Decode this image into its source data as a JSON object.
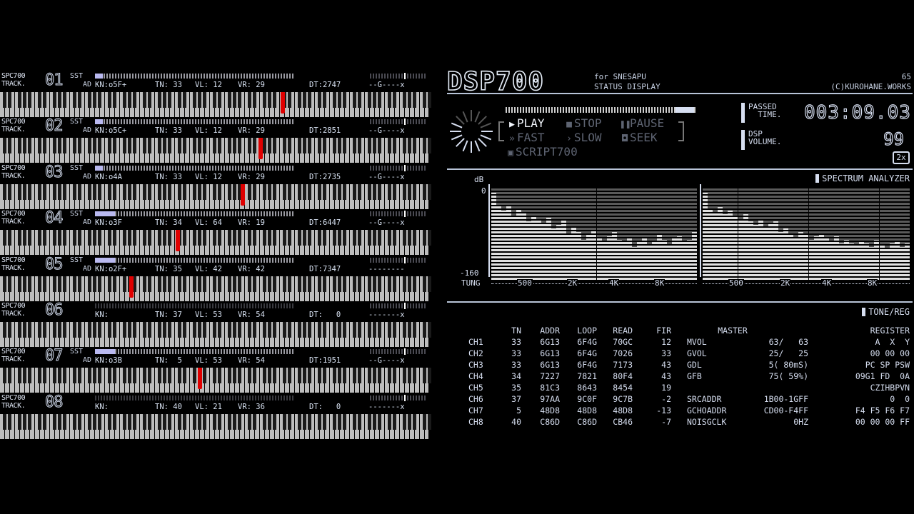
{
  "tracks": [
    {
      "spc": "SPC700",
      "label": "TRACK.",
      "num": "01",
      "sst": "SST",
      "ad": "AD",
      "kn": "KN:o5F+",
      "tn": "TN: 33",
      "vl": "VL: 12",
      "vr": "VR: 29",
      "dt": "DT:2747",
      "lfo": "--G----x",
      "env": 0.04,
      "note": 0.655,
      "active": true
    },
    {
      "spc": "SPC700",
      "label": "TRACK.",
      "num": "02",
      "sst": "SST",
      "ad": "AD",
      "kn": "KN:o5C+",
      "tn": "TN: 33",
      "vl": "VL: 12",
      "vr": "VR: 29",
      "dt": "DT:2851",
      "lfo": "--G----x",
      "env": 0.04,
      "note": 0.603,
      "active": true
    },
    {
      "spc": "SPC700",
      "label": "TRACK.",
      "num": "03",
      "sst": "SST",
      "ad": "AD",
      "kn": "KN:o4A",
      "tn": "TN: 33",
      "vl": "VL: 12",
      "vr": "VR: 29",
      "dt": "DT:2735",
      "lfo": "--G----x",
      "env": 0.04,
      "note": 0.561,
      "active": true
    },
    {
      "spc": "SPC700",
      "label": "TRACK.",
      "num": "04",
      "sst": "SST",
      "ad": "AD",
      "kn": "KN:o3F",
      "tn": "TN: 34",
      "vl": "VL: 64",
      "vr": "VR: 19",
      "dt": "DT:6447",
      "lfo": "--G----x",
      "env": 0.1,
      "note": 0.41,
      "active": true
    },
    {
      "spc": "SPC700",
      "label": "TRACK.",
      "num": "05",
      "sst": "SST",
      "ad": "AD",
      "kn": "KN:o2F+",
      "tn": "TN: 35",
      "vl": "VL: 42",
      "vr": "VR: 42",
      "dt": "DT:7347",
      "lfo": "--------",
      "env": 0.1,
      "note": 0.302,
      "active": true
    },
    {
      "spc": "SPC700",
      "label": "TRACK.",
      "num": "06",
      "sst": "",
      "ad": "",
      "kn": "KN:",
      "tn": "TN: 37",
      "vl": "VL: 53",
      "vr": "VR: 54",
      "dt": "DT:   0",
      "lfo": "-------x",
      "env": 0.0,
      "note": null,
      "active": false
    },
    {
      "spc": "SPC700",
      "label": "TRACK.",
      "num": "07",
      "sst": "SST",
      "ad": "AD",
      "kn": "KN:o3B",
      "tn": "TN:  5",
      "vl": "VL: 53",
      "vr": "VR: 54",
      "dt": "DT:1951",
      "lfo": "--G----x",
      "env": 0.1,
      "note": 0.462,
      "active": true
    },
    {
      "spc": "SPC700",
      "label": "TRACK.",
      "num": "08",
      "sst": "",
      "ad": "",
      "kn": "KN:",
      "tn": "TN: 40",
      "vl": "VL: 21",
      "vr": "VR: 36",
      "dt": "DT:   0",
      "lfo": "-------x",
      "env": 0.0,
      "note": null,
      "active": false
    }
  ],
  "dsp": {
    "logo": "DSP700",
    "sub1": "for SNESAPU",
    "sub2": "STATUS DISPLAY",
    "version": "65",
    "copyright": "(C)KUROHANE.WORKS",
    "progress": 0.9,
    "transport": {
      "play": "PLAY",
      "stop": "STOP",
      "pause": "PAUSE",
      "fast": "FAST",
      "slow": "SLOW",
      "seek": "SEEK",
      "script": "SCRIPT700"
    },
    "passed_label": "PASSED\n  TIME.",
    "timer": "003:09.03",
    "volume_label": "DSP\nVOLUME.",
    "volume": "99",
    "rate": "2x",
    "spectrum": {
      "title": "SPECTRUM ANALYZER",
      "db_label": "dB",
      "top": "0",
      "bottom": "-160",
      "tune_label": "TUNG",
      "ticks": [
        "500",
        "2K",
        "4K",
        "8K"
      ],
      "left": [
        0.95,
        0.82,
        0.76,
        0.82,
        0.7,
        0.78,
        0.74,
        0.64,
        0.7,
        0.66,
        0.62,
        0.68,
        0.56,
        0.6,
        0.66,
        0.5,
        0.58,
        0.52,
        0.44,
        0.5,
        0.54,
        0.46,
        0.42,
        0.48,
        0.52,
        0.44,
        0.42,
        0.46,
        0.36,
        0.42,
        0.46,
        0.38,
        0.42,
        0.5,
        0.44,
        0.38,
        0.46,
        0.48,
        0.42,
        0.44,
        0.52
      ],
      "right": [
        0.95,
        0.78,
        0.74,
        0.8,
        0.72,
        0.76,
        0.7,
        0.66,
        0.72,
        0.64,
        0.6,
        0.66,
        0.58,
        0.62,
        0.64,
        0.52,
        0.56,
        0.5,
        0.46,
        0.52,
        0.5,
        0.44,
        0.48,
        0.5,
        0.46,
        0.42,
        0.48,
        0.4,
        0.44,
        0.4,
        0.38,
        0.42,
        0.4,
        0.36,
        0.44,
        0.38,
        0.34,
        0.4,
        0.42,
        0.36,
        0.4
      ]
    },
    "tonereg": {
      "title": "TONE/REG",
      "headers": {
        "tn": "TN",
        "addr": "ADDR",
        "loop": "LOOP",
        "read": "READ",
        "fir": "FIR",
        "master": "MASTER",
        "register": "REGISTER"
      },
      "channels": [
        {
          "ch": "CH1",
          "tn": "33",
          "addr": "6G13",
          "loop": "6F4G",
          "read": "70GC",
          "fir": "12"
        },
        {
          "ch": "CH2",
          "tn": "33",
          "addr": "6G13",
          "loop": "6F4G",
          "read": "7026",
          "fir": "33"
        },
        {
          "ch": "CH3",
          "tn": "33",
          "addr": "6G13",
          "loop": "6F4G",
          "read": "7173",
          "fir": "43"
        },
        {
          "ch": "CH4",
          "tn": "34",
          "addr": "7227",
          "loop": "7821",
          "read": "80F4",
          "fir": "43"
        },
        {
          "ch": "CH5",
          "tn": "35",
          "addr": "81C3",
          "loop": "8643",
          "read": "8454",
          "fir": "19"
        },
        {
          "ch": "CH6",
          "tn": "37",
          "addr": "97AA",
          "loop": "9C0F",
          "read": "9C7B",
          "fir": "-2"
        },
        {
          "ch": "CH7",
          "tn": "5",
          "addr": "48D8",
          "loop": "48D8",
          "read": "48D8",
          "fir": "-13"
        },
        {
          "ch": "CH8",
          "tn": "40",
          "addr": "C86D",
          "loop": "C86D",
          "read": "CB46",
          "fir": "-7"
        }
      ],
      "master": [
        {
          "k": "MVOL",
          "v": "63/   63"
        },
        {
          "k": "GVOL",
          "v": "25/   25"
        },
        {
          "k": "GDL",
          "v": "5( 80mS)"
        },
        {
          "k": "GFB",
          "v": "75( 59%)"
        },
        {
          "k": "",
          "v": ""
        },
        {
          "k": "SRCADDR",
          "v": "1B00-1GFF"
        },
        {
          "k": "GCHOADDR",
          "v": "CD00-F4FF"
        },
        {
          "k": "NOISGCLK",
          "v": "0HZ"
        }
      ],
      "register": [
        "A  X  Y",
        "00 00 00",
        "PC SP PSW",
        "09G1 FD  0A",
        "CZIHBPVN",
        "0  0",
        "F4 F5 F6 F7",
        "00 00 00 FF"
      ]
    }
  }
}
